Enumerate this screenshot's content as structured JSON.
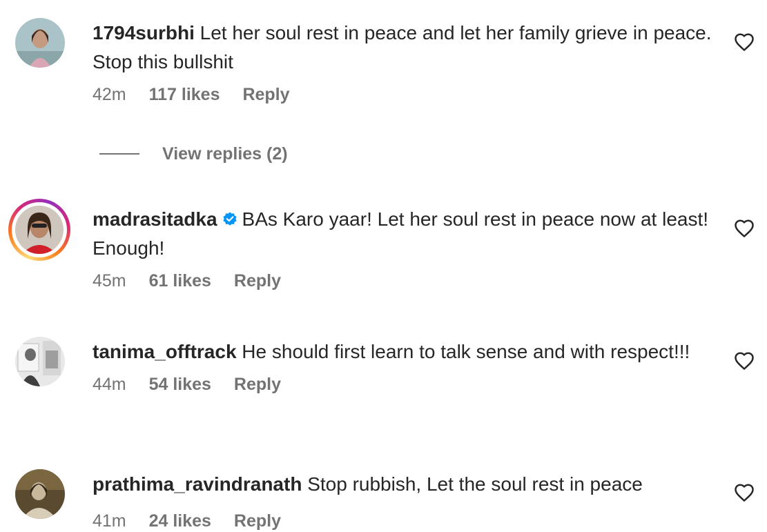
{
  "comments": [
    {
      "username": "1794surbhi",
      "text": "Let her soul rest in peace and let her family grieve in peace. Stop this bullshit",
      "time": "42m",
      "likes": "117 likes",
      "reply_label": "Reply",
      "view_replies": "View replies (2)"
    },
    {
      "username": "madrasitadka",
      "verified": true,
      "text": "BAs Karo yaar! Let her soul rest in peace now at least! Enough!",
      "time": "45m",
      "likes": "61 likes",
      "reply_label": "Reply"
    },
    {
      "username": "tanima_offtrack",
      "text": "He should first learn to talk sense and with respect!!!",
      "time": "44m",
      "likes": "54 likes",
      "reply_label": "Reply"
    },
    {
      "username": "prathima_ravindranath",
      "text": "Stop rubbish, Let the soul rest in peace",
      "time": "41m",
      "likes": "24 likes",
      "reply_label": "Reply"
    }
  ],
  "icons": {
    "like": "heart-outline-icon",
    "verified": "verified-badge-icon"
  },
  "colors": {
    "text": "#262626",
    "secondary": "#737373",
    "verified": "#0095f6"
  }
}
